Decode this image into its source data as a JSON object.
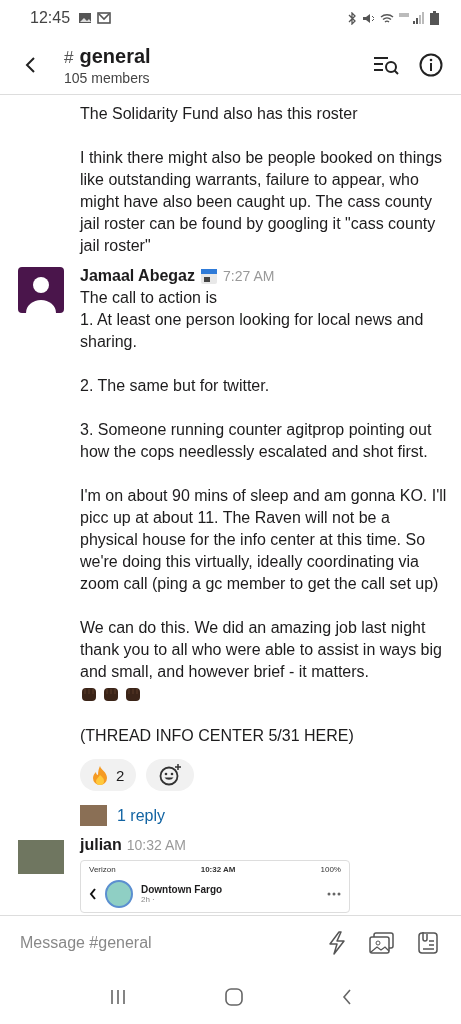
{
  "status_bar": {
    "time": "12:45"
  },
  "header": {
    "channel_prefix": "#",
    "channel": "general",
    "members": "105 members"
  },
  "messages": [
    {
      "kind": "continuation",
      "paragraphs": [
        {
          "text": "The Solidarity Fund also has this roster",
          "fist_emoji": false
        },
        {
          "text": "I think there might also be people booked on things like outstanding warrants, failure to appear, who might have also been caught up. The cass county jail roster can be found by googling it \"cass county jail roster\"",
          "fist_emoji": false
        }
      ]
    },
    {
      "kind": "message",
      "author": "Jamaal Abegaz",
      "time": "7:27 AM",
      "status_emoji": true,
      "avatar": {
        "kind": "silhouette"
      },
      "paragraphs": [
        {
          "text": "The call to action is\n1. At least one person looking for local news and sharing.",
          "fist_emoji": false
        },
        {
          "text": "2. The same but for twitter.",
          "fist_emoji": false
        },
        {
          "text": "3. Someone running counter agitprop pointing out how the cops needlessly escalated and shot first.",
          "fist_emoji": false
        },
        {
          "text": "I'm on about 90 mins of sleep and am gonna KO. I'll picc up at about 11. The Raven will not be a physical house for the info center at this time. So we're doing this virtually, ideally coordinating via zoom call (ping a gc member to get the call set up)",
          "fist_emoji": false
        },
        {
          "text": "We can do this. We did an amazing job last night thank you to all who were able to assist in ways big and small, and however brief - it matters.",
          "fist_emoji": true
        },
        {
          "text": "(THREAD INFO CENTER 5/31 HERE)",
          "fist_emoji": false
        }
      ],
      "reactions": [
        {
          "count": "2"
        }
      ],
      "replies": "1 reply"
    },
    {
      "kind": "message",
      "author": "julian",
      "time": "10:32 AM",
      "status_emoji": false,
      "avatar": {
        "kind": "photo"
      },
      "attachment": {
        "carrier": "Verizon",
        "time": "10:32 AM",
        "battery": "100%",
        "page": "Downtown Fargo",
        "age": "2h ·"
      }
    }
  ],
  "composer": {
    "placeholder": "Message #general"
  }
}
